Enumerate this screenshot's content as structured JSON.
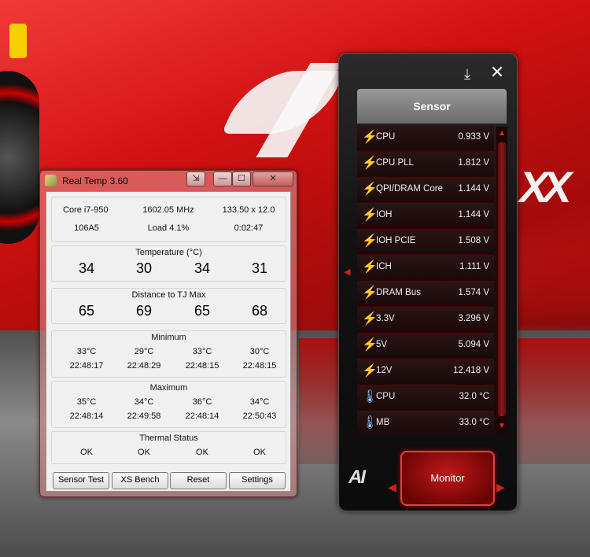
{
  "realtemp": {
    "title": "Real Temp 3.60",
    "cpu_model": "Core i7-950",
    "frequency": "1602.05 MHz",
    "multiplier": "133.50 x 12.0",
    "cpuid": "106A5",
    "load": "Load  4.1%",
    "uptime": "0:02:47",
    "temperature": {
      "title": "Temperature (°C)",
      "values": [
        "34",
        "30",
        "34",
        "31"
      ]
    },
    "distance": {
      "title": "Distance to TJ Max",
      "values": [
        "65",
        "69",
        "65",
        "68"
      ]
    },
    "minimum": {
      "title": "Minimum",
      "temps": [
        "33°C",
        "29°C",
        "33°C",
        "30°C"
      ],
      "times": [
        "22:48:17",
        "22:48:29",
        "22:48:15",
        "22:48:15"
      ]
    },
    "maximum": {
      "title": "Maximum",
      "temps": [
        "35°C",
        "34°C",
        "36°C",
        "34°C"
      ],
      "times": [
        "22:48:14",
        "22:49:58",
        "22:48:14",
        "22:50:43"
      ]
    },
    "thermal": {
      "title": "Thermal Status",
      "values": [
        "OK",
        "OK",
        "OK",
        "OK"
      ]
    },
    "buttons": {
      "sensor_test": "Sensor Test",
      "xs_bench": "XS Bench",
      "reset": "Reset",
      "settings": "Settings"
    },
    "titlebar": {
      "close": "✕",
      "minimize": "—",
      "maximize": "☐",
      "pin": "⇲"
    }
  },
  "gadget": {
    "header": "Sensor",
    "close": "✕",
    "download": "⤓",
    "monitor_label": "Monitor",
    "logo": "AI",
    "rows": [
      {
        "icon": "voltage-icon",
        "label": "CPU",
        "value": "0.933  V"
      },
      {
        "icon": "voltage-icon",
        "label": "CPU PLL",
        "value": "1.812  V"
      },
      {
        "icon": "voltage-icon",
        "label": "QPI/DRAM Core",
        "value": "1.144  V"
      },
      {
        "icon": "voltage-icon",
        "label": "IOH",
        "value": "1.144  V"
      },
      {
        "icon": "voltage-icon",
        "label": "IOH PCIE",
        "value": "1.508  V"
      },
      {
        "icon": "voltage-icon",
        "label": "ICH",
        "value": "1.111  V"
      },
      {
        "icon": "voltage-icon",
        "label": "DRAM Bus",
        "value": "1.574  V"
      },
      {
        "icon": "voltage-icon",
        "label": "3.3V",
        "value": "3.296  V"
      },
      {
        "icon": "voltage-icon",
        "label": "5V",
        "value": "5.094  V"
      },
      {
        "icon": "voltage-icon",
        "label": "12V",
        "value": "12.418  V"
      },
      {
        "icon": "thermometer-icon",
        "label": "CPU",
        "value": "32.0 °C"
      },
      {
        "icon": "thermometer-icon",
        "label": "MB",
        "value": "33.0 °C"
      }
    ]
  }
}
